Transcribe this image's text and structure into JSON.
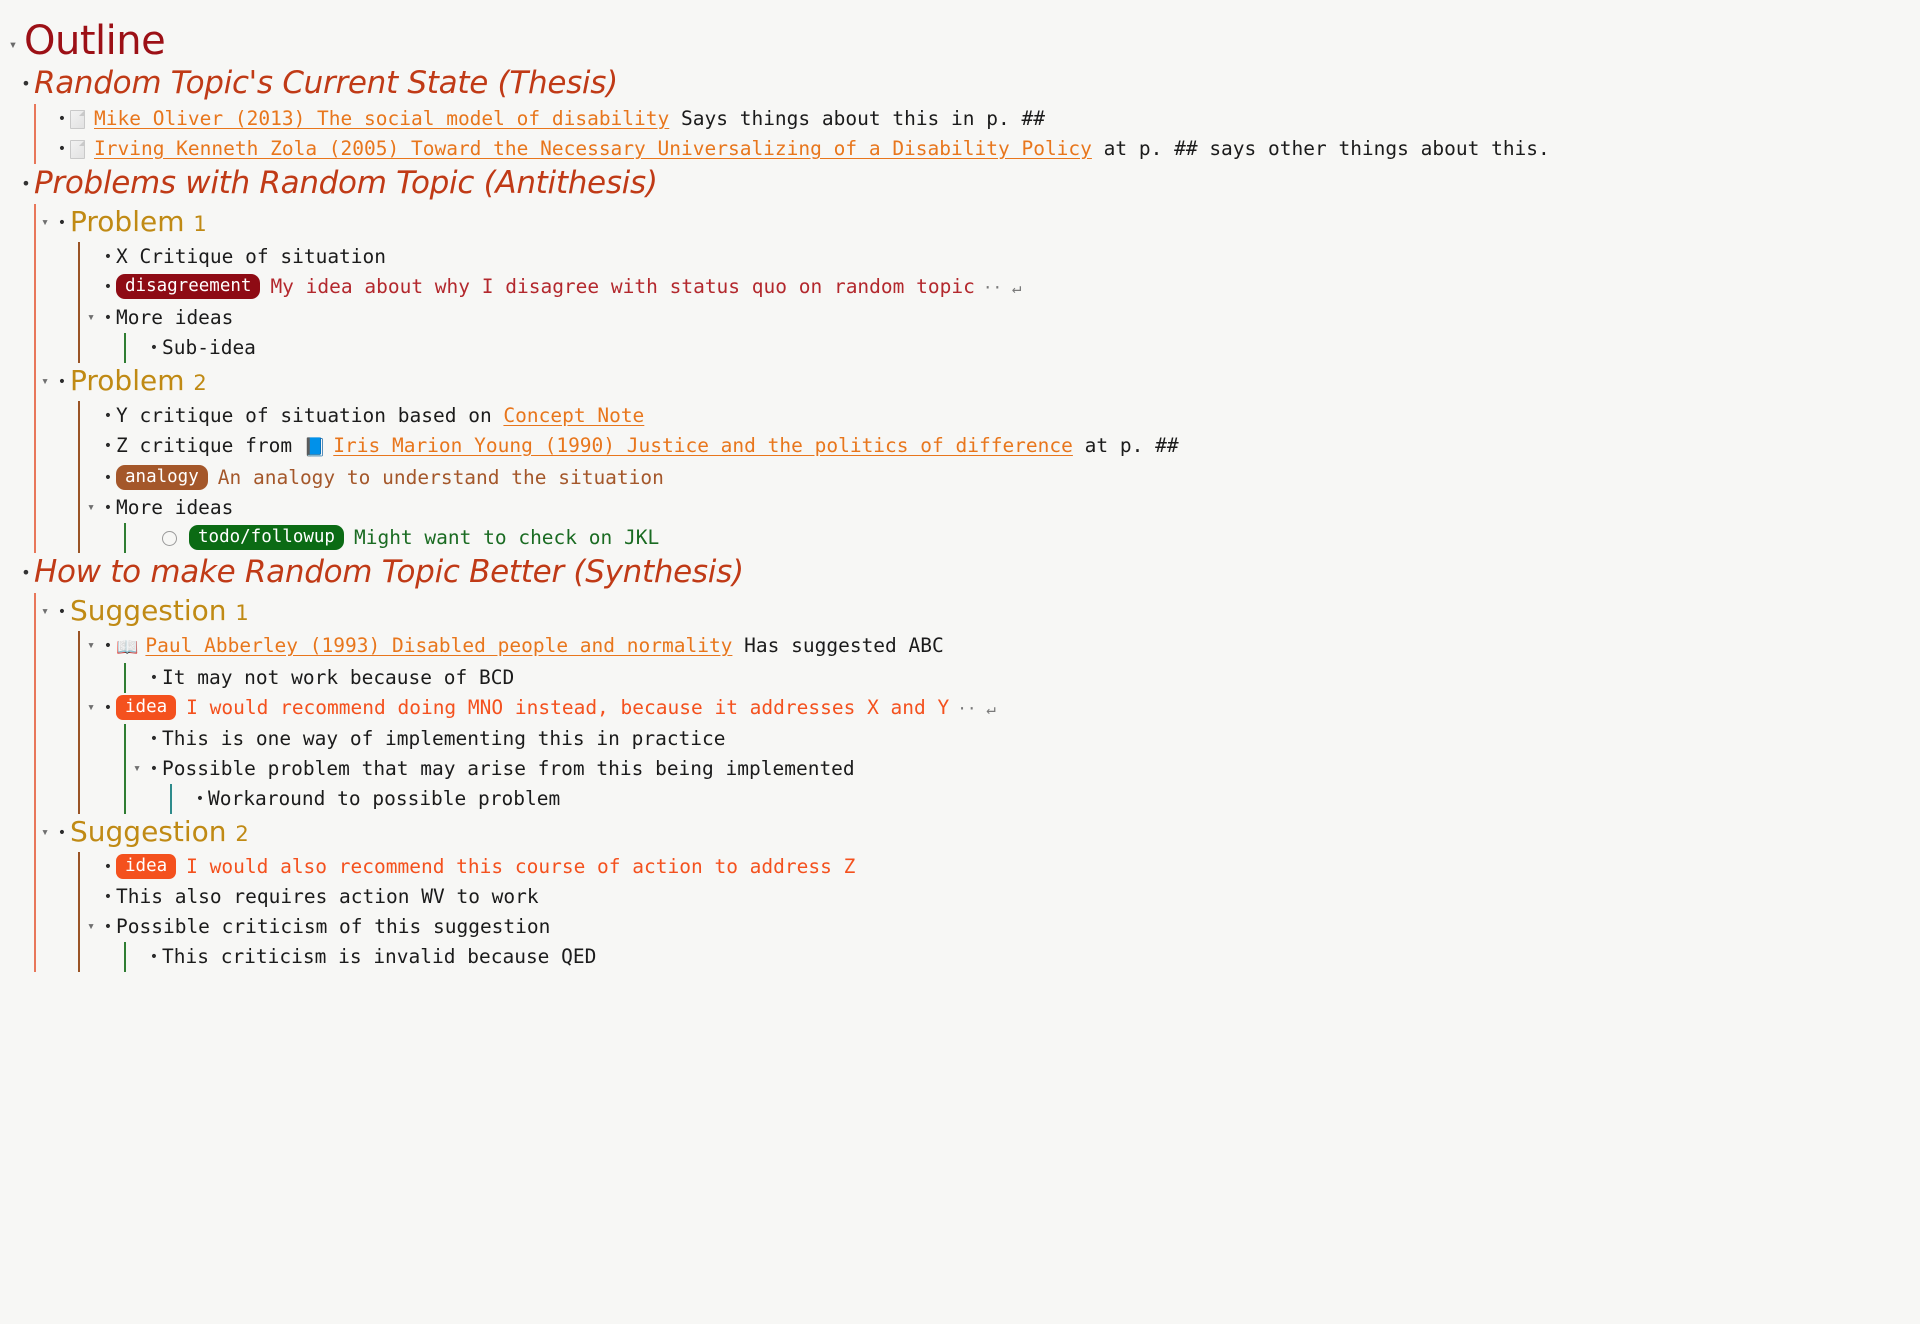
{
  "root": {
    "title": "Outline",
    "arrow": "collapse-arrow-down"
  },
  "colors": {
    "root_title": "#9c1016",
    "h1": "#c03a16",
    "h2": "#c08a14",
    "link": "#e8761c",
    "guide_level1": "#e8775a",
    "guide_level2": "#9a5426",
    "guide_level3": "#2f7d32",
    "guide_level4": "#2e8b8b",
    "tag_disagreement": "#8e0b14",
    "tag_analogy": "#a4572a",
    "tag_todo": "#0b6b14",
    "tag_idea": "#f4511e"
  },
  "sections": {
    "thesis": {
      "heading": "Random Topic's Current State (Thesis)",
      "items": [
        {
          "icon": "document-icon",
          "link": "Mike Oliver (2013) The social model of disability",
          "trailing": "Says things about this in p. ##"
        },
        {
          "icon": "document-icon",
          "link": "Irving Kenneth Zola (2005)  Toward the Necessary Universalizing of a Disability Policy",
          "trailing": "at p. ## says other things about this."
        }
      ]
    },
    "antithesis": {
      "heading": "Problems with Random Topic (Antithesis)",
      "problem1": {
        "heading_text": "Problem",
        "heading_num": "1",
        "items": {
          "critique": "X Critique of situation",
          "tag_label": "disagreement",
          "tag_text": "My idea about why I disagree with status quo on random topic",
          "tag_suffix": "·· ↵",
          "more_ideas": "More ideas",
          "sub_idea": "Sub-idea"
        }
      },
      "problem2": {
        "heading_text": "Problem",
        "heading_num": "2",
        "items": {
          "y_critique_pre": "Y critique of situation based on ",
          "y_critique_link": "Concept Note",
          "z_critique_pre": "Z critique from ",
          "z_critique_emoji": "📘",
          "z_critique_link": "Iris Marion Young (1990)  Justice and the politics of difference",
          "z_critique_post": "at p. ##",
          "analogy_tag": "analogy",
          "analogy_text": "An analogy to understand the situation",
          "more_ideas": "More ideas",
          "todo_tag": "todo/followup",
          "todo_text": "Might want to check on JKL"
        }
      }
    },
    "synthesis": {
      "heading": "How to make Random Topic Better (Synthesis)",
      "suggestion1": {
        "heading_text": "Suggestion",
        "heading_num": "1",
        "items": {
          "abberley_emoji": "📖",
          "abberley_link": "Paul Abberley (1993)  Disabled people and normality",
          "abberley_trailing": "Has suggested ABC",
          "may_not_work": "It may not work because of BCD",
          "idea_tag": "idea",
          "idea_text": "I would recommend doing MNO instead, because it addresses X and Y",
          "idea_suffix": "·· ↵",
          "one_way": "This is one way of implementing this in practice",
          "possible_problem": "Possible problem that may arise from this being implemented",
          "workaround": "Workaround to possible problem"
        }
      },
      "suggestion2": {
        "heading_text": "Suggestion",
        "heading_num": "2",
        "items": {
          "idea_tag": "idea",
          "idea_text": "I would also recommend this course of action to address Z",
          "requires_action": "This also requires action WV to work",
          "possible_criticism": "Possible criticism of this suggestion",
          "criticism_invalid": "This criticism is invalid because QED"
        }
      }
    }
  },
  "glyphs": {
    "arrow_down": "▾",
    "bullet": "•",
    "bullet_small": "•"
  }
}
